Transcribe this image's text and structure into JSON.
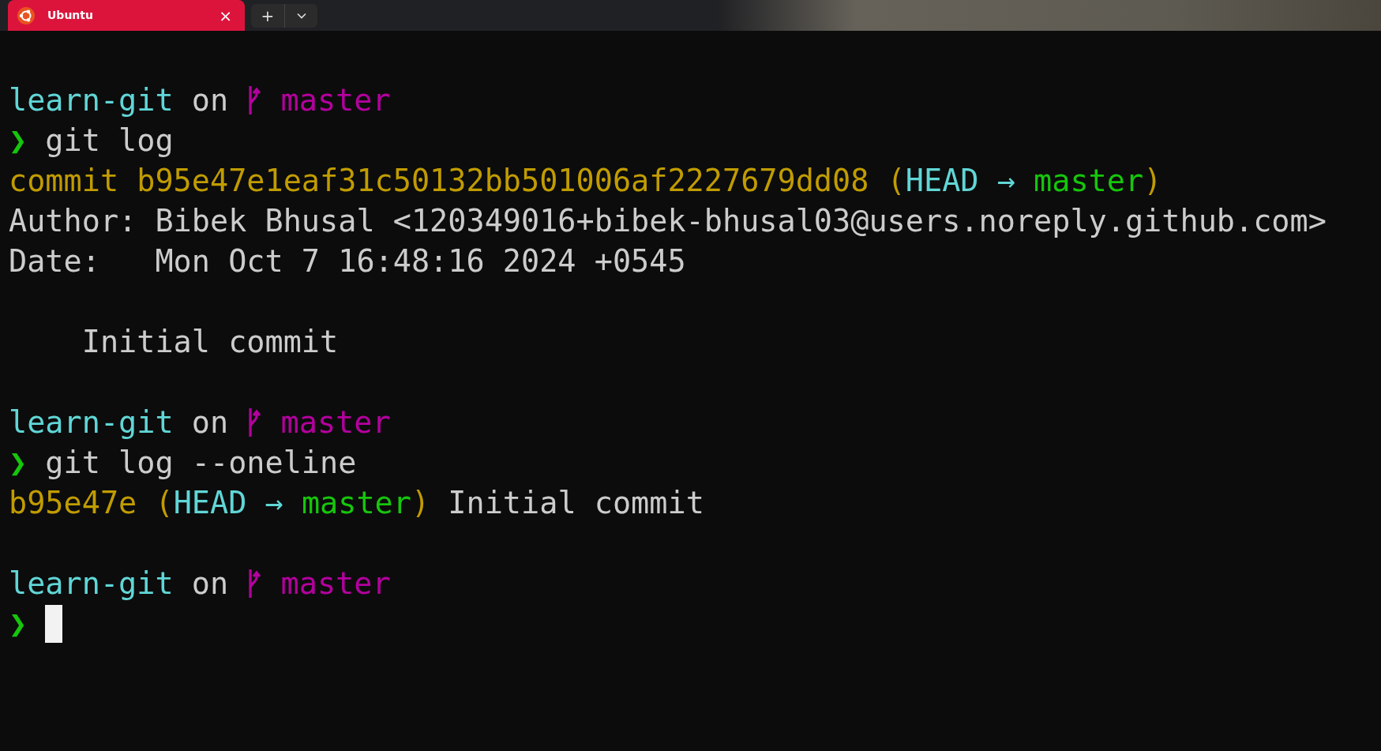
{
  "tab_bar": {
    "tabs": [
      {
        "title": "Ubuntu",
        "selected": true,
        "close": "×"
      }
    ],
    "new_tab": "+"
  },
  "terminal": {
    "lines": [
      {
        "kind": "text",
        "segments": [
          {
            "text": "learn-git",
            "color": "#61d6d6"
          },
          {
            "text": " on ",
            "color": "#cccccc"
          },
          {
            "kind": "branch-icon",
            "color": "#b4009e"
          },
          {
            "text": " master",
            "color": "#b4009e"
          }
        ]
      },
      {
        "kind": "text",
        "segments": [
          {
            "text": "❯",
            "color": "#16c60c"
          },
          {
            "text": " git log",
            "color": "#cccccc"
          }
        ]
      },
      {
        "kind": "text",
        "segments": [
          {
            "text": "commit b95e47e1eaf31c50132bb501006af2227679dd08 (",
            "color": "#c19c00"
          },
          {
            "text": "HEAD → ",
            "color": "#61d6d6"
          },
          {
            "text": "master",
            "color": "#16c60c"
          },
          {
            "text": ")",
            "color": "#c19c00"
          }
        ]
      },
      {
        "kind": "text",
        "segments": [
          {
            "text": "Author: Bibek Bhusal <120349016+bibek-bhusal03@users.noreply.github.com>",
            "color": "#cccccc"
          }
        ]
      },
      {
        "kind": "text",
        "segments": [
          {
            "text": "Date:   Mon Oct 7 16:48:16 2024 +0545",
            "color": "#cccccc"
          }
        ]
      },
      {
        "kind": "blank"
      },
      {
        "kind": "text",
        "segments": [
          {
            "text": "    Initial commit",
            "color": "#cccccc"
          }
        ]
      },
      {
        "kind": "blank"
      },
      {
        "kind": "text",
        "segments": [
          {
            "text": "learn-git",
            "color": "#61d6d6"
          },
          {
            "text": " on ",
            "color": "#cccccc"
          },
          {
            "kind": "branch-icon",
            "color": "#b4009e"
          },
          {
            "text": " master",
            "color": "#b4009e"
          }
        ]
      },
      {
        "kind": "text",
        "segments": [
          {
            "text": "❯",
            "color": "#16c60c"
          },
          {
            "text": " git log --oneline",
            "color": "#cccccc"
          }
        ]
      },
      {
        "kind": "text",
        "segments": [
          {
            "text": "b95e47e (",
            "color": "#c19c00"
          },
          {
            "text": "HEAD → ",
            "color": "#61d6d6"
          },
          {
            "text": "master",
            "color": "#16c60c"
          },
          {
            "text": ")",
            "color": "#c19c00"
          },
          {
            "text": " Initial commit",
            "color": "#cccccc"
          }
        ]
      },
      {
        "kind": "blank"
      },
      {
        "kind": "text",
        "segments": [
          {
            "text": "learn-git",
            "color": "#61d6d6"
          },
          {
            "text": " on ",
            "color": "#cccccc"
          },
          {
            "kind": "branch-icon",
            "color": "#b4009e"
          },
          {
            "text": " master",
            "color": "#b4009e"
          }
        ]
      },
      {
        "kind": "text",
        "segments": [
          {
            "text": "❯",
            "color": "#16c60c"
          },
          {
            "kind": "cursor",
            "color": "#f2f2f2"
          }
        ]
      }
    ]
  }
}
